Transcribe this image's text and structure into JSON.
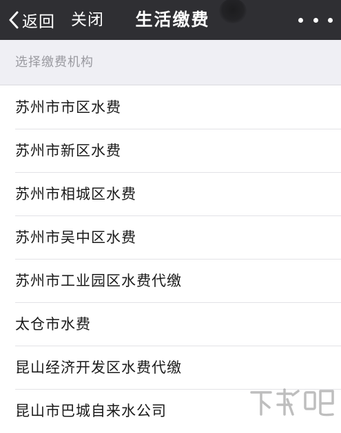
{
  "navbar": {
    "back_label": "返回",
    "close_label": "关闭",
    "title": "生活缴费"
  },
  "section": {
    "header": "选择缴费机构"
  },
  "institutions": [
    "苏州市市区水费",
    "苏州市新区水费",
    "苏州市相城区水费",
    "苏州市吴中区水费",
    "苏州市工业园区水费代缴",
    "太仓市水费",
    "昆山经济开发区水费代缴",
    "昆山市巴城自来水公司"
  ],
  "colors": {
    "navbar_bg": "#2f2f33",
    "page_bg": "#efeff4",
    "list_bg": "#ffffff",
    "text_primary": "#1a1a1a",
    "text_secondary": "#9a9aa0",
    "divider": "#e2e2e6"
  },
  "icons": {
    "back": "chevron-left-icon",
    "more": "ellipsis-horizontal-icon"
  }
}
